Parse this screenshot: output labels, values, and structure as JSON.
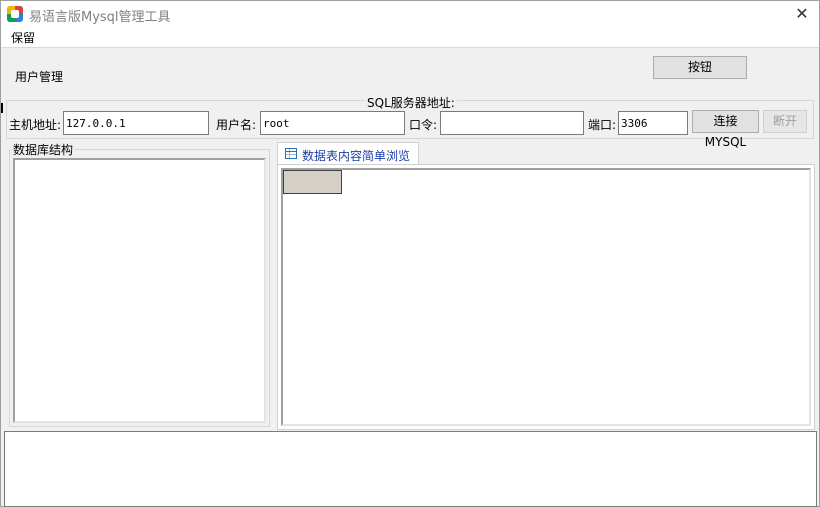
{
  "window": {
    "title": "易语言版Mysql管理工具",
    "close_symbol": "✕"
  },
  "menu": {
    "items": [
      {
        "label": "保留"
      }
    ]
  },
  "user_management_label": "用户管理",
  "top_button_label": "按钮",
  "connection": {
    "group_title": "SQL服务器地址:",
    "host_label": "主机地址:",
    "host_value": "127.0.0.1",
    "user_label": "用户名:",
    "user_value": "root",
    "password_label": "口令:",
    "password_value": "",
    "port_label": "端口:",
    "port_value": "3306",
    "connect_button": "连接MYSQL",
    "disconnect_button": "断开"
  },
  "db_structure": {
    "title": "数据库结构"
  },
  "tabs": [
    {
      "label": "数据表内容简单浏览",
      "icon": "table-icon",
      "active": true
    }
  ],
  "log": {
    "value": ""
  },
  "colors": {
    "tab_text": "#1a3fa8",
    "disabled_text": "#a0a0a0",
    "grid_header": "#d4d0c8"
  }
}
